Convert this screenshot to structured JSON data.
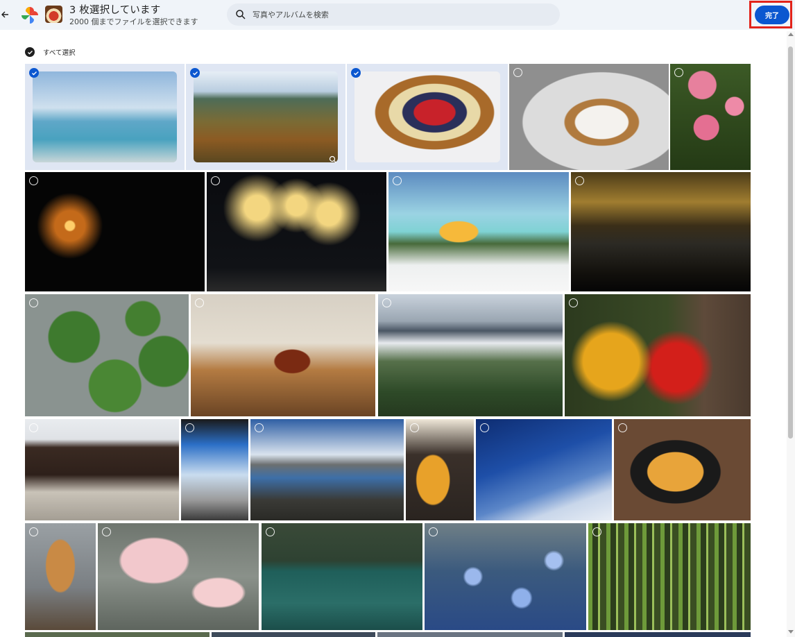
{
  "header": {
    "title": "3 枚選択しています",
    "subtitle": "2000 個までファイルを選択できます",
    "search_placeholder": "写真やアルバムを検索",
    "done_label": "完了"
  },
  "select_all": {
    "label": "すべて選択"
  },
  "colors": {
    "accent": "#0b57d0",
    "topbar_bg": "#f0f4f9",
    "highlight_frame": "#e2231a"
  },
  "photos": [
    {
      "name": "photo-ocean",
      "selected": true
    },
    {
      "name": "photo-mountain-autumn",
      "selected": true
    },
    {
      "name": "photo-fruit-tart",
      "selected": true
    },
    {
      "name": "photo-mousse-cake",
      "selected": false
    },
    {
      "name": "photo-pink-roses",
      "selected": false
    },
    {
      "name": "photo-sparkler",
      "selected": false
    },
    {
      "name": "photo-fireworks",
      "selected": false
    },
    {
      "name": "photo-beer-beach",
      "selected": false
    },
    {
      "name": "photo-sunset-sea",
      "selected": false
    },
    {
      "name": "photo-watermelons",
      "selected": false
    },
    {
      "name": "photo-dark-beer",
      "selected": false
    },
    {
      "name": "photo-mountain-ridge",
      "selected": false
    },
    {
      "name": "photo-red-leaves",
      "selected": false
    },
    {
      "name": "photo-temple-hall",
      "selected": false
    },
    {
      "name": "photo-kyoto-tower",
      "selected": false
    },
    {
      "name": "photo-harbor",
      "selected": false
    },
    {
      "name": "photo-beer-cup",
      "selected": false
    },
    {
      "name": "photo-airplane-wing",
      "selected": false
    },
    {
      "name": "photo-ramen",
      "selected": false
    },
    {
      "name": "photo-shiba-dog",
      "selected": false
    },
    {
      "name": "photo-flamingo",
      "selected": false
    },
    {
      "name": "photo-green-lake",
      "selected": false
    },
    {
      "name": "photo-blue-flowers",
      "selected": false
    },
    {
      "name": "photo-bamboo",
      "selected": false
    }
  ]
}
